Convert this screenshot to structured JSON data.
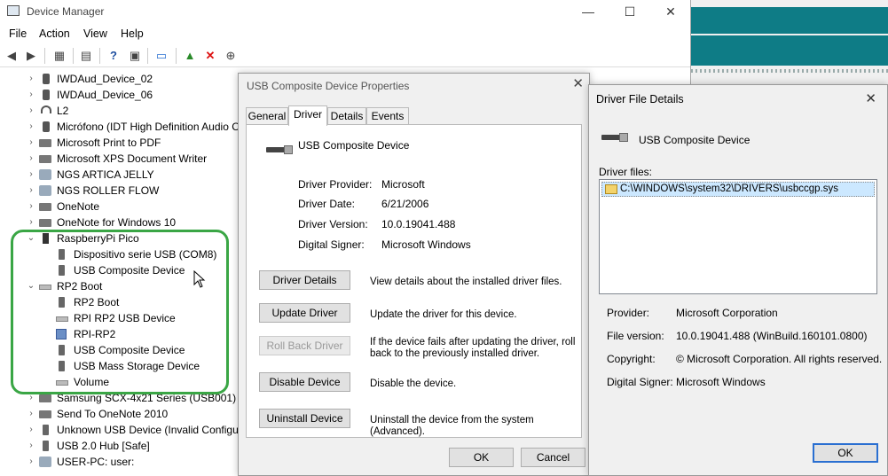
{
  "device_manager": {
    "title": "Device Manager",
    "window_controls": {
      "minimize": "—",
      "maximize": "☐",
      "close": "✕"
    },
    "menu": [
      "File",
      "Action",
      "View",
      "Help"
    ],
    "toolbar_icons": [
      "back-icon",
      "forward-icon",
      "properties-grid-icon",
      "properties-icon",
      "help-icon",
      "view-icon",
      "monitor-icon",
      "update-driver-icon",
      "uninstall-icon",
      "download-icon"
    ],
    "tree": [
      {
        "label": "IWDAud_Device_02",
        "icon": "audio",
        "expanded": false,
        "depth": 0
      },
      {
        "label": "IWDAud_Device_06",
        "icon": "audio",
        "expanded": false,
        "depth": 0
      },
      {
        "label": "L2",
        "icon": "headphones",
        "expanded": false,
        "depth": 0
      },
      {
        "label": "Micrófono (IDT High Definition Audio C",
        "icon": "audio",
        "expanded": false,
        "depth": 0
      },
      {
        "label": "Microsoft Print to PDF",
        "icon": "printer",
        "expanded": false,
        "depth": 0
      },
      {
        "label": "Microsoft XPS Document Writer",
        "icon": "printer",
        "expanded": false,
        "depth": 0
      },
      {
        "label": "NGS ARTICA JELLY",
        "icon": "net",
        "expanded": false,
        "depth": 0
      },
      {
        "label": "NGS ROLLER FLOW",
        "icon": "net",
        "expanded": false,
        "depth": 0
      },
      {
        "label": "OneNote",
        "icon": "printer",
        "expanded": false,
        "depth": 0
      },
      {
        "label": "OneNote for Windows 10",
        "icon": "printer",
        "expanded": false,
        "depth": 0
      },
      {
        "label": "RaspberryPi Pico",
        "icon": "dark",
        "expanded": true,
        "depth": 0
      },
      {
        "label": "Dispositivo serie USB (COM8)",
        "icon": "usb",
        "depth": 1
      },
      {
        "label": "USB Composite Device",
        "icon": "usb",
        "depth": 1
      },
      {
        "label": "RP2 Boot",
        "icon": "drive",
        "expanded": true,
        "depth": 0
      },
      {
        "label": "RP2 Boot",
        "icon": "usb",
        "depth": 1
      },
      {
        "label": "RPI RP2 USB Device",
        "icon": "drive",
        "depth": 1
      },
      {
        "label": "RPI-RP2",
        "icon": "blue",
        "depth": 1
      },
      {
        "label": "USB Composite Device",
        "icon": "usb",
        "depth": 1
      },
      {
        "label": "USB Mass Storage Device",
        "icon": "usb",
        "depth": 1
      },
      {
        "label": "Volume",
        "icon": "drive",
        "depth": 1
      },
      {
        "label": "Samsung SCX-4x21 Series (USB001)",
        "icon": "printer",
        "expanded": false,
        "depth": 0
      },
      {
        "label": "Send To OneNote 2010",
        "icon": "printer",
        "expanded": false,
        "depth": 0
      },
      {
        "label": "Unknown USB Device (Invalid Configur",
        "icon": "usb",
        "expanded": false,
        "depth": 0
      },
      {
        "label": "USB 2.0 Hub [Safe]",
        "icon": "usb",
        "expanded": false,
        "depth": 0
      },
      {
        "label": "USER-PC: user:",
        "icon": "net",
        "expanded": false,
        "depth": 0
      }
    ]
  },
  "properties_dialog": {
    "title": "USB Composite Device Properties",
    "close_glyph": "✕",
    "tabs": [
      "General",
      "Driver",
      "Details",
      "Events"
    ],
    "active_tab": "Driver",
    "device_name": "USB Composite Device",
    "info": [
      {
        "label": "Driver Provider:",
        "value": "Microsoft"
      },
      {
        "label": "Driver Date:",
        "value": "6/21/2006"
      },
      {
        "label": "Driver Version:",
        "value": "10.0.19041.488"
      },
      {
        "label": "Digital Signer:",
        "value": "Microsoft Windows"
      }
    ],
    "actions": [
      {
        "button": "Driver Details",
        "description": "View details about the installed driver files.",
        "enabled": true
      },
      {
        "button": "Update Driver",
        "description": "Update the driver for this device.",
        "enabled": true
      },
      {
        "button": "Roll Back Driver",
        "description": "If the device fails after updating the driver, roll back to the previously installed driver.",
        "enabled": false
      },
      {
        "button": "Disable Device",
        "description": "Disable the device.",
        "enabled": true
      },
      {
        "button": "Uninstall Device",
        "description": "Uninstall the device from the system (Advanced).",
        "enabled": true
      }
    ],
    "ok_label": "OK",
    "cancel_label": "Cancel"
  },
  "driver_file_details": {
    "title": "Driver File Details",
    "close_glyph": "✕",
    "device_name": "USB Composite Device",
    "files_label": "Driver files:",
    "files": [
      "C:\\WINDOWS\\system32\\DRIVERS\\usbccgp.sys"
    ],
    "details": [
      {
        "label": "Provider:",
        "value": "Microsoft Corporation"
      },
      {
        "label": "File version:",
        "value": "10.0.19041.488 (WinBuild.160101.0800)"
      },
      {
        "label": "Copyright:",
        "value": "© Microsoft Corporation. All rights reserved."
      },
      {
        "label": "Digital Signer:",
        "value": "Microsoft Windows"
      }
    ],
    "ok_label": "OK"
  },
  "colors": {
    "highlight_outline": "#3aa645",
    "background_app_teal": "#0e7c86",
    "selection": "#cce8ff",
    "default_button_border": "#2a6fd1"
  }
}
